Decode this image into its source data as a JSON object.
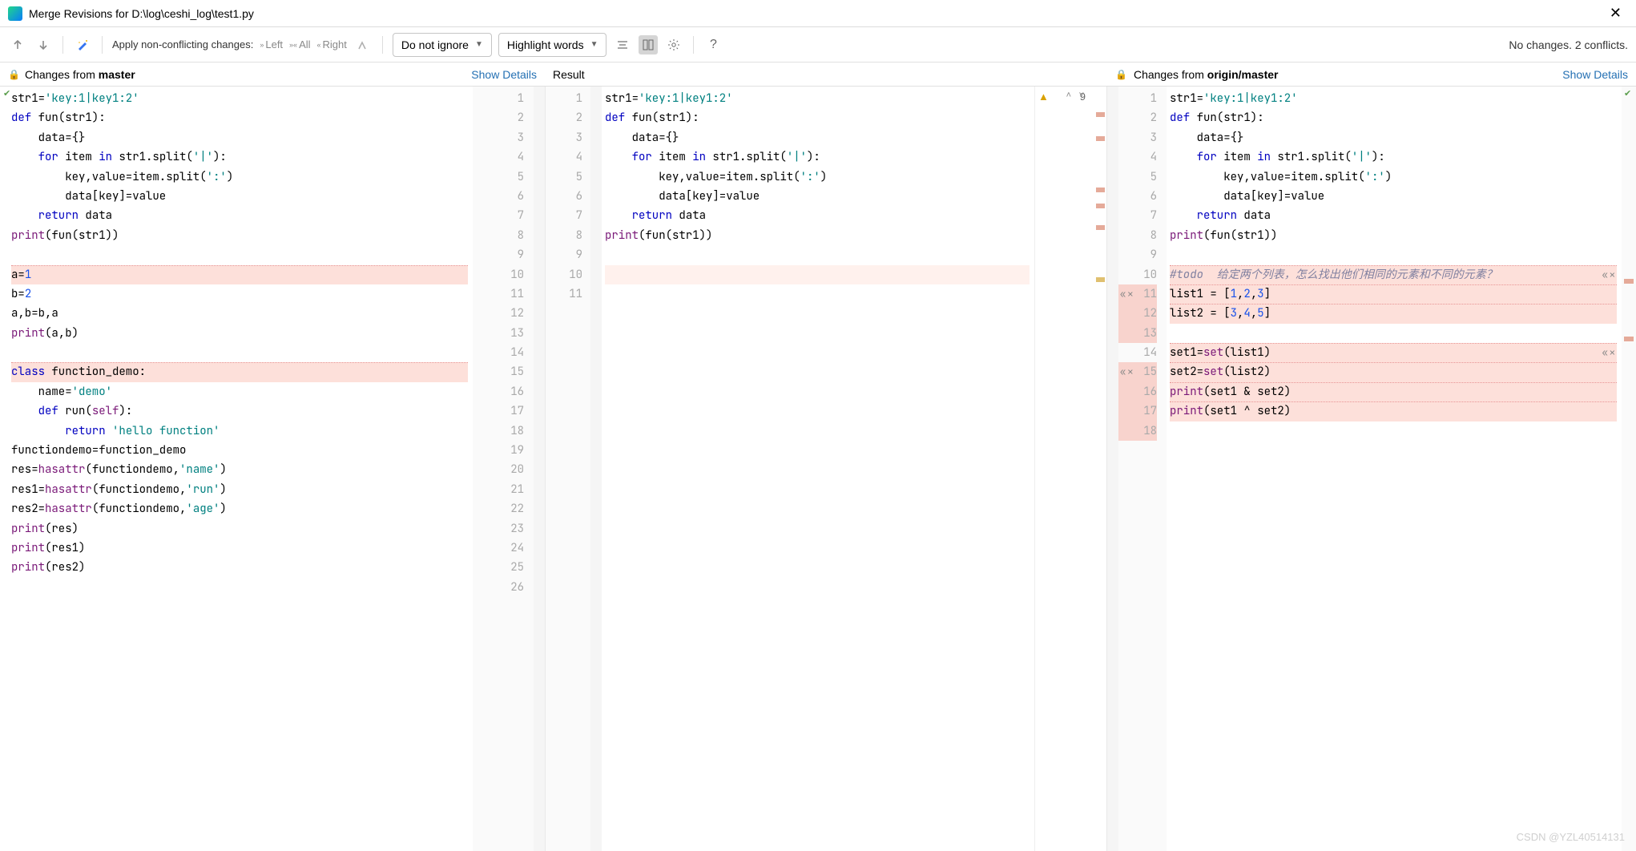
{
  "title": "Merge Revisions for D:\\log\\ceshi_log\\test1.py",
  "toolbar": {
    "apply_label": "Apply non-conflicting changes:",
    "left": "Left",
    "all": "All",
    "right": "Right",
    "ignore_dd": "Do not ignore",
    "highlight_dd": "Highlight words",
    "status": "No changes. 2 conflicts."
  },
  "headers": {
    "left_prefix": "Changes from ",
    "left_branch": "master",
    "mid": "Result",
    "right_prefix": "Changes from ",
    "right_branch": "origin/master",
    "details": "Show Details"
  },
  "warn_count": "9",
  "left_code": {
    "lines": [
      {
        "n": 1,
        "seg": [
          [
            "",
            "str1="
          ],
          [
            "str",
            "'key:1|key1:2'"
          ]
        ]
      },
      {
        "n": 2,
        "seg": [
          [
            "kw",
            "def "
          ],
          [
            "",
            "fun(str1):"
          ]
        ]
      },
      {
        "n": 3,
        "seg": [
          [
            "",
            "    data={}"
          ]
        ]
      },
      {
        "n": 4,
        "seg": [
          [
            "",
            "    "
          ],
          [
            "kw",
            "for "
          ],
          [
            "",
            "item "
          ],
          [
            "kw",
            "in "
          ],
          [
            "",
            "str1.split("
          ],
          [
            "str",
            "'|'"
          ],
          [
            "",
            "):"
          ]
        ]
      },
      {
        "n": 5,
        "seg": [
          [
            "",
            "        key,value=item.split("
          ],
          [
            "str",
            "':'"
          ],
          [
            "",
            ")"
          ]
        ]
      },
      {
        "n": 6,
        "seg": [
          [
            "",
            "        data[key]=value"
          ]
        ]
      },
      {
        "n": 7,
        "seg": [
          [
            "",
            "    "
          ],
          [
            "kw",
            "return "
          ],
          [
            "",
            "data"
          ]
        ]
      },
      {
        "n": 8,
        "seg": [
          [
            "bi",
            "print"
          ],
          [
            "",
            "(fun(str1))"
          ]
        ]
      },
      {
        "n": 9,
        "seg": [
          [
            "",
            ""
          ]
        ]
      },
      {
        "n": 10,
        "conflict": true,
        "seg": [
          [
            "",
            "a="
          ],
          [
            "num",
            "1"
          ]
        ]
      },
      {
        "n": 11,
        "seg": [
          [
            "",
            "b="
          ],
          [
            "num",
            "2"
          ]
        ]
      },
      {
        "n": 12,
        "seg": [
          [
            "",
            "a,b=b,a"
          ]
        ]
      },
      {
        "n": 13,
        "seg": [
          [
            "bi",
            "print"
          ],
          [
            "",
            "(a,b)"
          ]
        ]
      },
      {
        "n": 14,
        "seg": [
          [
            "",
            ""
          ]
        ]
      },
      {
        "n": 15,
        "conflict": true,
        "seg": [
          [
            "kw",
            "class "
          ],
          [
            "",
            "function_demo:"
          ]
        ]
      },
      {
        "n": 16,
        "seg": [
          [
            "",
            "    name="
          ],
          [
            "str",
            "'demo'"
          ]
        ]
      },
      {
        "n": 17,
        "seg": [
          [
            "",
            "    "
          ],
          [
            "kw",
            "def "
          ],
          [
            "",
            "run("
          ],
          [
            "bi",
            "self"
          ],
          [
            "",
            "):"
          ]
        ]
      },
      {
        "n": 18,
        "seg": [
          [
            "",
            "        "
          ],
          [
            "kw",
            "return "
          ],
          [
            "str",
            "'hello function'"
          ]
        ]
      },
      {
        "n": 19,
        "seg": [
          [
            "",
            "functiondemo=function_demo"
          ]
        ]
      },
      {
        "n": 20,
        "seg": [
          [
            "",
            "res="
          ],
          [
            "bi",
            "hasattr"
          ],
          [
            "",
            "(functiondemo,"
          ],
          [
            "str",
            "'name'"
          ],
          [
            "",
            ")"
          ]
        ]
      },
      {
        "n": 21,
        "seg": [
          [
            "",
            "res1="
          ],
          [
            "bi",
            "hasattr"
          ],
          [
            "",
            "(functiondemo,"
          ],
          [
            "str",
            "'run'"
          ],
          [
            "",
            ")"
          ]
        ]
      },
      {
        "n": 22,
        "seg": [
          [
            "",
            "res2="
          ],
          [
            "bi",
            "hasattr"
          ],
          [
            "",
            "(functiondemo,"
          ],
          [
            "str",
            "'age'"
          ],
          [
            "",
            ")"
          ]
        ]
      },
      {
        "n": 23,
        "seg": [
          [
            "bi",
            "print"
          ],
          [
            "",
            "(res)"
          ]
        ]
      },
      {
        "n": 24,
        "seg": [
          [
            "bi",
            "print"
          ],
          [
            "",
            "(res1)"
          ]
        ]
      },
      {
        "n": 25,
        "seg": [
          [
            "bi",
            "print"
          ],
          [
            "",
            "(res2)"
          ]
        ]
      },
      {
        "n": 26,
        "seg": [
          [
            "",
            ""
          ]
        ]
      }
    ]
  },
  "left_gutter_nums": [
    1,
    2,
    3,
    4,
    5,
    6,
    7,
    8,
    9,
    10,
    11,
    12,
    13,
    14,
    15,
    16,
    17,
    18,
    19,
    20,
    21,
    22,
    23,
    24,
    25,
    26
  ],
  "mid_gutter_nums": [
    1,
    2,
    3,
    4,
    5,
    6,
    7,
    8,
    9,
    10,
    11
  ],
  "mid_code": {
    "lines": [
      {
        "n": 1,
        "seg": [
          [
            "",
            "str1="
          ],
          [
            "str",
            "'key:1|key1:2'"
          ]
        ]
      },
      {
        "n": 2,
        "seg": [
          [
            "kw",
            "def "
          ],
          [
            "",
            "fun(str1):"
          ]
        ]
      },
      {
        "n": 3,
        "seg": [
          [
            "",
            "    data={}"
          ]
        ]
      },
      {
        "n": 4,
        "seg": [
          [
            "",
            "    "
          ],
          [
            "kw",
            "for "
          ],
          [
            "",
            "item "
          ],
          [
            "kw",
            "in "
          ],
          [
            "",
            "str1.split("
          ],
          [
            "str",
            "'|'"
          ],
          [
            "",
            "):"
          ]
        ]
      },
      {
        "n": 5,
        "seg": [
          [
            "",
            "        key,value=item.split("
          ],
          [
            "str",
            "':'"
          ],
          [
            "",
            ")"
          ]
        ]
      },
      {
        "n": 6,
        "seg": [
          [
            "",
            "        data[key]=value"
          ]
        ]
      },
      {
        "n": 7,
        "seg": [
          [
            "",
            "    "
          ],
          [
            "kw",
            "return "
          ],
          [
            "",
            "data"
          ]
        ]
      },
      {
        "n": 8,
        "seg": [
          [
            "bi",
            "print"
          ],
          [
            "",
            "(fun(str1))"
          ]
        ]
      },
      {
        "n": 9,
        "seg": [
          [
            "",
            ""
          ]
        ]
      },
      {
        "n": 10,
        "caret": true,
        "seg": [
          [
            "",
            ""
          ]
        ]
      }
    ]
  },
  "right_gutter_nums": [
    1,
    2,
    3,
    4,
    5,
    6,
    7,
    8,
    9,
    10,
    11,
    12,
    13,
    14,
    15,
    16,
    17,
    18
  ],
  "right_code": {
    "lines": [
      {
        "n": 1,
        "seg": [
          [
            "",
            "str1="
          ],
          [
            "str",
            "'key:1|key1:2'"
          ]
        ]
      },
      {
        "n": 2,
        "seg": [
          [
            "kw",
            "def "
          ],
          [
            "",
            "fun(str1):"
          ]
        ]
      },
      {
        "n": 3,
        "seg": [
          [
            "",
            "    data={}"
          ]
        ]
      },
      {
        "n": 4,
        "seg": [
          [
            "",
            "    "
          ],
          [
            "kw",
            "for "
          ],
          [
            "",
            "item "
          ],
          [
            "kw",
            "in "
          ],
          [
            "",
            "str1.split("
          ],
          [
            "str",
            "'|'"
          ],
          [
            "",
            "):"
          ]
        ]
      },
      {
        "n": 5,
        "seg": [
          [
            "",
            "        key,value=item.split("
          ],
          [
            "str",
            "':'"
          ],
          [
            "",
            ")"
          ]
        ]
      },
      {
        "n": 6,
        "seg": [
          [
            "",
            "        data[key]=value"
          ]
        ]
      },
      {
        "n": 7,
        "seg": [
          [
            "",
            "    "
          ],
          [
            "kw",
            "return "
          ],
          [
            "",
            "data"
          ]
        ]
      },
      {
        "n": 8,
        "seg": [
          [
            "bi",
            "print"
          ],
          [
            "",
            "(fun(str1))"
          ]
        ]
      },
      {
        "n": 9,
        "seg": [
          [
            "",
            ""
          ]
        ]
      },
      {
        "n": 10,
        "conflict": true,
        "act": true,
        "seg": [
          [
            "cmt",
            "#todo  给定两个列表，怎么找出他们相同的元素和不同的元素？"
          ]
        ]
      },
      {
        "n": 11,
        "conflict": true,
        "seg": [
          [
            "",
            "list1 = ["
          ],
          [
            "num",
            "1"
          ],
          [
            "",
            ","
          ],
          [
            "num",
            "2"
          ],
          [
            "",
            ","
          ],
          [
            "num",
            "3"
          ],
          [
            "",
            "]"
          ]
        ]
      },
      {
        "n": 12,
        "conflict": true,
        "seg": [
          [
            "",
            "list2 = ["
          ],
          [
            "num",
            "3"
          ],
          [
            "",
            ","
          ],
          [
            "num",
            "4"
          ],
          [
            "",
            ","
          ],
          [
            "num",
            "5"
          ],
          [
            "",
            "]"
          ]
        ]
      },
      {
        "n": 13,
        "seg": [
          [
            "",
            ""
          ]
        ]
      },
      {
        "n": 14,
        "conflict": true,
        "act": true,
        "seg": [
          [
            "",
            "set1="
          ],
          [
            "bi",
            "set"
          ],
          [
            "",
            "(list1)"
          ]
        ]
      },
      {
        "n": 15,
        "conflict": true,
        "seg": [
          [
            "",
            "set2="
          ],
          [
            "bi",
            "set"
          ],
          [
            "",
            "(list2)"
          ]
        ]
      },
      {
        "n": 16,
        "conflict": true,
        "seg": [
          [
            "bi",
            "print"
          ],
          [
            "",
            "(set1 & set2)"
          ]
        ]
      },
      {
        "n": 17,
        "conflict": true,
        "seg": [
          [
            "bi",
            "print"
          ],
          [
            "",
            "(set1 ^ set2)"
          ]
        ]
      }
    ]
  },
  "watermark": "CSDN @YZL40514131"
}
